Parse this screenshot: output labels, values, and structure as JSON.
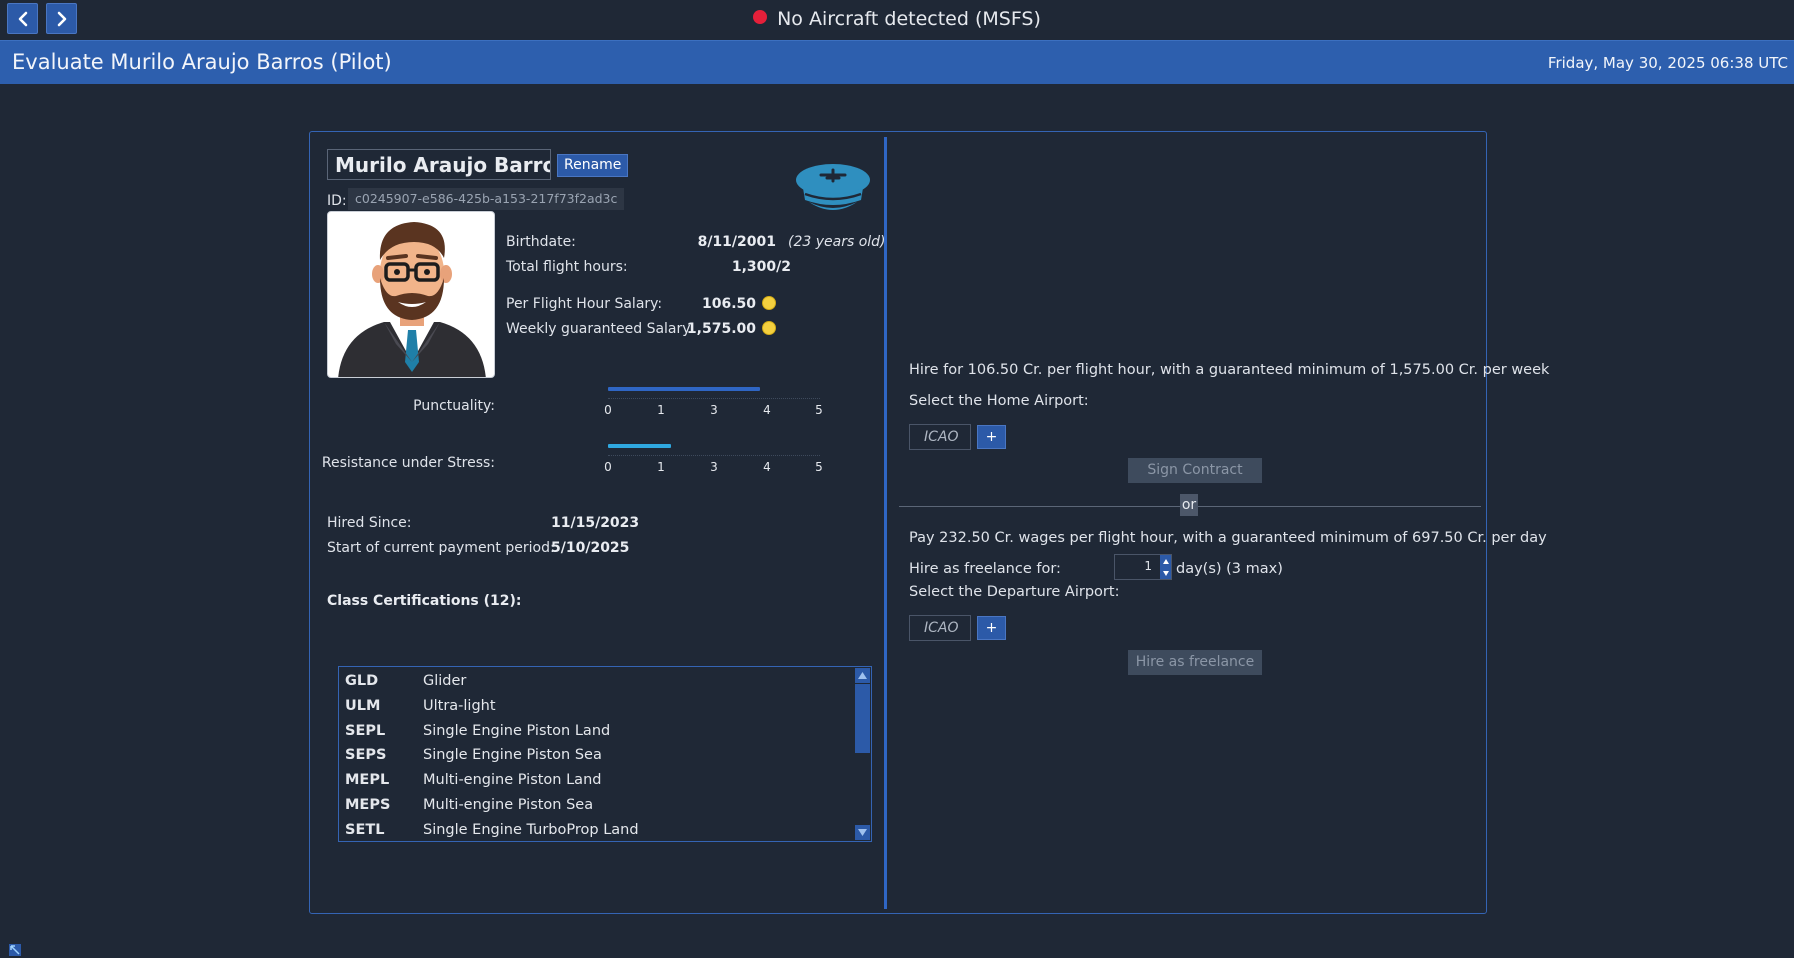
{
  "topbar": {
    "status_text": "No Aircraft detected (MSFS)",
    "status_color": "#e5203a"
  },
  "header": {
    "title": "Evaluate Murilo Araujo Barros (Pilot)",
    "datetime": "Friday, May 30, 2025 06:38 UTC"
  },
  "pilot": {
    "name": "Murilo Araujo Barros",
    "rename_label": "Rename",
    "id_label": "ID:",
    "id_value": "c0245907-e586-425b-a153-217f73f2ad3c",
    "details": {
      "birthdate_label": "Birthdate:",
      "birthdate_value": "8/11/2001",
      "age_note": "(23 years old)",
      "flight_hours_label": "Total flight hours:",
      "flight_hours_value": "1,300/2",
      "per_hour_salary_label": "Per Flight Hour Salary:",
      "per_hour_salary_value": "106.50",
      "weekly_salary_label": "Weekly guaranteed Salary:",
      "weekly_salary_value": "1,575.00"
    },
    "ratings": [
      {
        "label": "Punctuality:",
        "value": 3.6,
        "color": "#2f66c4",
        "ticks": [
          "0",
          "1",
          "3",
          "4",
          "5"
        ]
      },
      {
        "label": "Resistance under Stress:",
        "value": 1.5,
        "color": "#2fa8e0",
        "ticks": [
          "0",
          "1",
          "3",
          "4",
          "5"
        ]
      }
    ],
    "employment": {
      "hired_since_label": "Hired Since:",
      "hired_since_value": "11/15/2023",
      "period_label": "Start of current payment period:",
      "period_value": "5/10/2025"
    },
    "certifications_title": "Class Certifications (12):",
    "certifications": [
      {
        "code": "GLD",
        "desc": "Glider"
      },
      {
        "code": "ULM",
        "desc": "Ultra-light"
      },
      {
        "code": "SEPL",
        "desc": "Single Engine Piston Land"
      },
      {
        "code": "SEPS",
        "desc": "Single Engine Piston Sea"
      },
      {
        "code": "MEPL",
        "desc": "Multi-engine Piston Land"
      },
      {
        "code": "MEPS",
        "desc": "Multi-engine Piston Sea"
      },
      {
        "code": "SETL",
        "desc": "Single Engine TurboProp Land"
      }
    ]
  },
  "hire": {
    "contract_text": "Hire for 106.50 Cr. per flight hour, with a guaranteed minimum of 1,575.00 Cr. per week",
    "home_airport_label": "Select the Home Airport:",
    "icao_placeholder": "ICAO",
    "plus_label": "+",
    "sign_contract_label": "Sign Contract",
    "or_label": "or",
    "freelance_text": "Pay 232.50 Cr. wages per flight hour, with a guaranteed minimum of 697.50 Cr. per day",
    "freelance_for_label": "Hire as freelance for:",
    "freelance_days": "1",
    "days_suffix": "day(s) (3 max)",
    "departure_airport_label": "Select the Departure Airport:",
    "hire_freelance_label": "Hire as freelance"
  }
}
